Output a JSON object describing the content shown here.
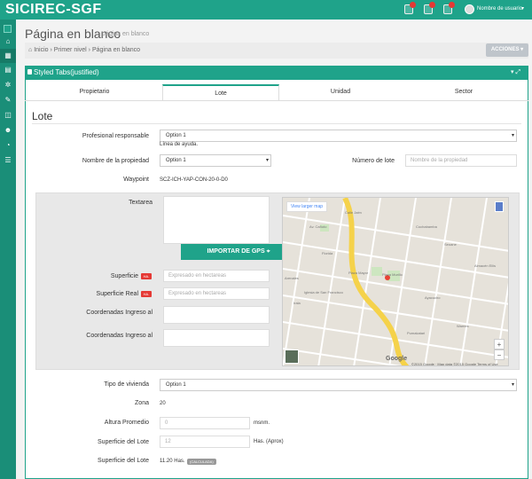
{
  "app": {
    "brand": "SICIREC-SGF",
    "user": "Nombre de usuario"
  },
  "page": {
    "title": "Página en blanco",
    "subtitle": "página en blanco"
  },
  "breadcrumb": {
    "items": [
      "Inicio",
      "Primer nivel",
      "Página en blanco"
    ],
    "actions_label": "ACCIONES"
  },
  "panel": {
    "title": "Styled Tabs(justified)"
  },
  "tabs": [
    "Propietario",
    "Lote",
    "Unidad",
    "Sector"
  ],
  "section": {
    "title": "Lote"
  },
  "form": {
    "profesional_label": "Profesional responsable",
    "profesional_value": "Option 1",
    "profesional_help": "Línea de ayuda.",
    "propiedad_label": "Nombre de la propiedad",
    "propiedad_value": "Option 1",
    "numero_lote_label": "Número de lote",
    "numero_lote_placeholder": "Nombre de la propiedad",
    "waypoint_label": "Waypoint",
    "waypoint_value": "SCZ-ICH-YAP-CON-20-0-D0",
    "textarea_label": "Textarea",
    "gps_button": "IMPORTAR DE GPS",
    "superficie_label": "Superficie",
    "superficie_placeholder": "Expresado en hectareas",
    "superficie_real_label": "Superficie Real",
    "superficie_real_placeholder": "Expresado en hectareas",
    "badge_ha": "HA.",
    "coord1_label": "Coordenadas Ingreso al",
    "coord2_label": "Coordenadas Ingreso al",
    "vivienda_label": "Tipo de vivienda",
    "vivienda_value": "Option 1",
    "zona_label": "Zona",
    "zona_value": "20",
    "altura_label": "Altura Promedio",
    "altura_value": "0",
    "altura_unit": "msnm.",
    "sup_lote_label": "Superficie del Lote",
    "sup_lote_value": "12",
    "sup_lote_unit": "Has. (Aprox)",
    "sup_lote2_label": "Superficie del Lote",
    "sup_lote2_value": "11.20 Has.",
    "calculada": "(CALCULADA)"
  },
  "map": {
    "link": "View larger map",
    "labels": [
      "Calle Jaén",
      "Av. Cañoto",
      "Plaza Mayor",
      "Plaza Murillo",
      "Florida",
      "Arenales",
      "Irala",
      "Cochabamba",
      "Ayacucho",
      "Seoane",
      "Av. Pizarro",
      "Barrio",
      "Ballivián",
      "Plaza de Hacienda",
      "Iglesia de San Francisco",
      "Puerto",
      "Potosí",
      "Puerto Anillo",
      "Colón",
      "Florida",
      "Potosí",
      "Yapacaní",
      "Pumakatari",
      "Chacoluibestol",
      "Warnes",
      "Vanegas",
      "Av. Camacho",
      "Av. Cordón Chacabuco",
      "Mercado Los Pozos",
      "Av. Vídal",
      "Campero",
      "Junín",
      "Beni",
      "Sucre",
      "Bolívar",
      "Bozo Enlaces",
      "Almacén Ellis"
    ],
    "zoom_in": "+",
    "zoom_out": "−",
    "google": "Google",
    "attribution": "©2015 Google · Map data ©2015 Google   Terms of Use"
  },
  "colors": {
    "accent": "#1fa38a",
    "sidebar": "#1a8e78",
    "badge": "#e53935"
  }
}
